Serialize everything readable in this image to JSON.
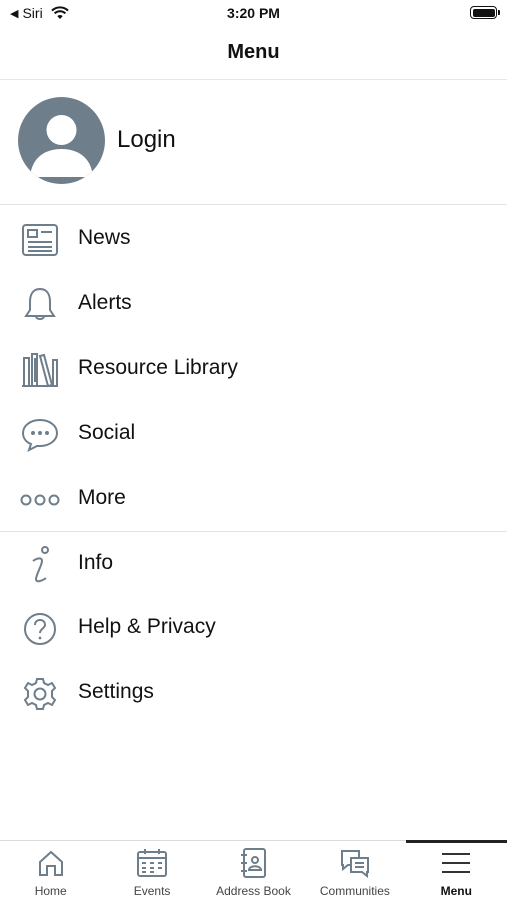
{
  "status_bar": {
    "carrier": "Siri",
    "time": "3:20 PM"
  },
  "nav": {
    "title": "Menu"
  },
  "login": {
    "label": "Login"
  },
  "menu": {
    "items": [
      {
        "label": "News",
        "icon": "news-icon"
      },
      {
        "label": "Alerts",
        "icon": "bell-icon"
      },
      {
        "label": "Resource Library",
        "icon": "library-icon"
      },
      {
        "label": "Social",
        "icon": "chat-bubble-icon"
      },
      {
        "label": "More",
        "icon": "more-dots-icon"
      },
      {
        "label": "Info",
        "icon": "info-icon"
      },
      {
        "label": "Help & Privacy",
        "icon": "help-icon"
      },
      {
        "label": "Settings",
        "icon": "gear-icon"
      }
    ]
  },
  "tabs": [
    {
      "label": "Home",
      "icon": "home-icon"
    },
    {
      "label": "Events",
      "icon": "calendar-icon"
    },
    {
      "label": "Address Book",
      "icon": "address-book-icon"
    },
    {
      "label": "Communities",
      "icon": "communities-icon"
    },
    {
      "label": "Menu",
      "icon": "hamburger-icon",
      "active": true
    }
  ],
  "colors": {
    "icon": "#6f7e8b",
    "text": "#111111",
    "separator": "#e2e2e2"
  }
}
